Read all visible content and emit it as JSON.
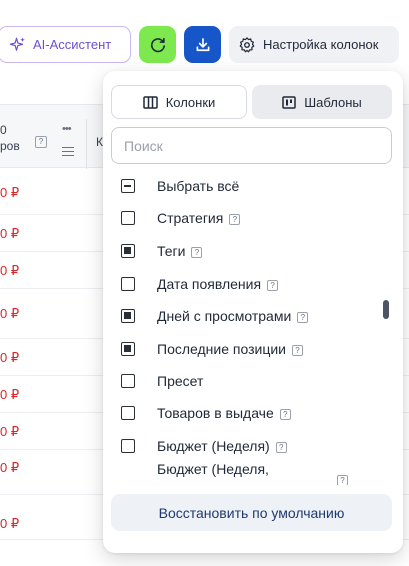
{
  "toolbar": {
    "ai_label": "AI-Ассистент",
    "settings_label": "Настройка колонок"
  },
  "table": {
    "header": {
      "col1_line1": "0",
      "col1_line2": "ров",
      "col2_line1": "К"
    },
    "rows": [
      {
        "price": "0 ₽"
      },
      {
        "price": "0 ₽"
      },
      {
        "price": "0 ₽"
      },
      {
        "price": "0 ₽"
      },
      {
        "price": "0 ₽"
      },
      {
        "price": "0 ₽"
      },
      {
        "price": "0 ₽"
      },
      {
        "price": "0 ₽"
      },
      {
        "price": "0 ₽"
      }
    ]
  },
  "panel": {
    "tab_columns": "Колонки",
    "tab_templates": "Шаблоны",
    "search_placeholder": "Поиск",
    "items": [
      {
        "label": "Выбрать всё",
        "state": "partial",
        "info": false
      },
      {
        "label": "Стратегия",
        "state": "unchecked",
        "info": true
      },
      {
        "label": "Теги",
        "state": "checked",
        "info": true
      },
      {
        "label": "Дата появления",
        "state": "unchecked",
        "info": true
      },
      {
        "label": "Дней с просмотрами",
        "state": "checked",
        "info": true
      },
      {
        "label": "Последние позиции",
        "state": "checked",
        "info": true
      },
      {
        "label": "Пресет",
        "state": "unchecked",
        "info": false
      },
      {
        "label": "Товаров в выдаче",
        "state": "unchecked",
        "info": true
      },
      {
        "label": "Бюджет (Неделя)",
        "state": "unchecked",
        "info": true
      },
      {
        "label": "Бюджет (Неделя,",
        "state": "unchecked",
        "info": true
      }
    ],
    "restore_label": "Восстановить по умолчанию"
  }
}
